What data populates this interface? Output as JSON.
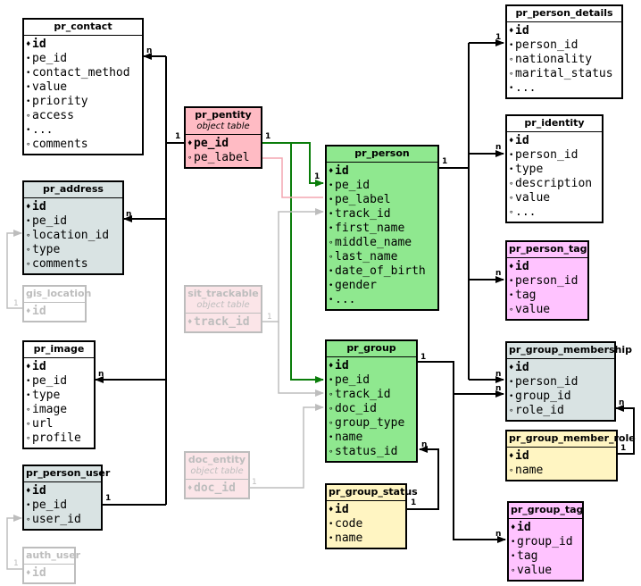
{
  "markers": {
    "pk": "♦",
    "required": "•",
    "optional": "∘"
  },
  "tables": [
    {
      "id": "pr_contact",
      "name": "pr_contact",
      "color": "white",
      "fields": [
        {
          "name": "id",
          "kind": "pk"
        },
        {
          "name": "pe_id",
          "kind": "required"
        },
        {
          "name": "contact_method",
          "kind": "required"
        },
        {
          "name": "value",
          "kind": "required"
        },
        {
          "name": "priority",
          "kind": "required"
        },
        {
          "name": "access",
          "kind": "optional"
        },
        {
          "name": "...",
          "kind": "required"
        },
        {
          "name": "comments",
          "kind": "optional"
        }
      ]
    },
    {
      "id": "pr_address",
      "name": "pr_address",
      "color": "gray",
      "fields": [
        {
          "name": "id",
          "kind": "pk"
        },
        {
          "name": "pe_id",
          "kind": "required"
        },
        {
          "name": "location_id",
          "kind": "optional"
        },
        {
          "name": "type",
          "kind": "optional"
        },
        {
          "name": "comments",
          "kind": "optional"
        }
      ]
    },
    {
      "id": "gis_location",
      "name": "gis_location",
      "color": "faded",
      "fields": [
        {
          "name": "id",
          "kind": "pk"
        }
      ]
    },
    {
      "id": "pr_image",
      "name": "pr_image",
      "color": "white",
      "fields": [
        {
          "name": "id",
          "kind": "pk"
        },
        {
          "name": "pe_id",
          "kind": "required"
        },
        {
          "name": "type",
          "kind": "required"
        },
        {
          "name": "image",
          "kind": "optional"
        },
        {
          "name": "url",
          "kind": "optional"
        },
        {
          "name": "profile",
          "kind": "optional"
        }
      ]
    },
    {
      "id": "pr_person_user",
      "name": "pr_person_user",
      "color": "gray",
      "fields": [
        {
          "name": "id",
          "kind": "pk"
        },
        {
          "name": "pe_id",
          "kind": "required"
        },
        {
          "name": "user_id",
          "kind": "optional"
        }
      ]
    },
    {
      "id": "auth_user",
      "name": "auth_user",
      "color": "faded",
      "fields": [
        {
          "name": "id",
          "kind": "pk"
        }
      ]
    },
    {
      "id": "pr_pentity",
      "name": "pr_pentity",
      "subtitle": "object table",
      "color": "pink",
      "fields": [
        {
          "name": "pe_id",
          "kind": "pk"
        },
        {
          "name": "pe_label",
          "kind": "optional"
        }
      ]
    },
    {
      "id": "sit_trackable",
      "name": "sit_trackable",
      "subtitle": "object table",
      "color": "fadedpink",
      "fields": [
        {
          "name": "track_id",
          "kind": "pk"
        }
      ]
    },
    {
      "id": "doc_entity",
      "name": "doc_entity",
      "subtitle": "object table",
      "color": "fadedpink",
      "fields": [
        {
          "name": "doc_id",
          "kind": "pk"
        }
      ]
    },
    {
      "id": "pr_person",
      "name": "pr_person",
      "color": "green",
      "fields": [
        {
          "name": "id",
          "kind": "pk"
        },
        {
          "name": "pe_id",
          "kind": "required"
        },
        {
          "name": "pe_label",
          "kind": "required"
        },
        {
          "name": "track_id",
          "kind": "required"
        },
        {
          "name": "first_name",
          "kind": "required"
        },
        {
          "name": "middle_name",
          "kind": "optional"
        },
        {
          "name": "last_name",
          "kind": "optional"
        },
        {
          "name": "date_of_birth",
          "kind": "required"
        },
        {
          "name": "gender",
          "kind": "required"
        },
        {
          "name": "...",
          "kind": "required"
        }
      ]
    },
    {
      "id": "pr_group",
      "name": "pr_group",
      "color": "green",
      "fields": [
        {
          "name": "id",
          "kind": "pk"
        },
        {
          "name": "pe_id",
          "kind": "required"
        },
        {
          "name": "track_id",
          "kind": "optional"
        },
        {
          "name": "doc_id",
          "kind": "optional"
        },
        {
          "name": "group_type",
          "kind": "optional"
        },
        {
          "name": "name",
          "kind": "required"
        },
        {
          "name": "status_id",
          "kind": "optional"
        }
      ]
    },
    {
      "id": "pr_group_status",
      "name": "pr_group_status",
      "color": "yellow",
      "fields": [
        {
          "name": "id",
          "kind": "pk"
        },
        {
          "name": "code",
          "kind": "required"
        },
        {
          "name": "name",
          "kind": "required"
        }
      ]
    },
    {
      "id": "pr_person_details",
      "name": "pr_person_details",
      "color": "white",
      "fields": [
        {
          "name": "id",
          "kind": "pk"
        },
        {
          "name": "person_id",
          "kind": "required"
        },
        {
          "name": "nationality",
          "kind": "optional"
        },
        {
          "name": "marital_status",
          "kind": "optional"
        },
        {
          "name": "...",
          "kind": "required"
        }
      ]
    },
    {
      "id": "pr_identity",
      "name": "pr_identity",
      "color": "white",
      "fields": [
        {
          "name": "id",
          "kind": "pk"
        },
        {
          "name": "person_id",
          "kind": "required"
        },
        {
          "name": "type",
          "kind": "required"
        },
        {
          "name": "description",
          "kind": "optional"
        },
        {
          "name": "value",
          "kind": "optional"
        },
        {
          "name": "...",
          "kind": "optional"
        }
      ]
    },
    {
      "id": "pr_person_tag",
      "name": "pr_person_tag",
      "color": "magenta",
      "fields": [
        {
          "name": "id",
          "kind": "pk"
        },
        {
          "name": "person_id",
          "kind": "required"
        },
        {
          "name": "tag",
          "kind": "required"
        },
        {
          "name": "value",
          "kind": "optional"
        }
      ]
    },
    {
      "id": "pr_group_membership",
      "name": "pr_group_membership",
      "color": "gray",
      "fields": [
        {
          "name": "id",
          "kind": "pk"
        },
        {
          "name": "person_id",
          "kind": "required"
        },
        {
          "name": "group_id",
          "kind": "required"
        },
        {
          "name": "role_id",
          "kind": "optional"
        }
      ]
    },
    {
      "id": "pr_group_member_role",
      "name": "pr_group_member_role",
      "color": "yellow",
      "fields": [
        {
          "name": "id",
          "kind": "pk"
        },
        {
          "name": "name",
          "kind": "optional"
        }
      ]
    },
    {
      "id": "pr_group_tag",
      "name": "pr_group_tag",
      "color": "magenta",
      "fields": [
        {
          "name": "id",
          "kind": "pk"
        },
        {
          "name": "group_id",
          "kind": "required"
        },
        {
          "name": "tag",
          "kind": "required"
        },
        {
          "name": "value",
          "kind": "optional"
        }
      ]
    }
  ],
  "edge_labels": {
    "one": "1",
    "many": "n"
  },
  "colors": {
    "edge": "#000000",
    "inherit": "#0a7d0a",
    "faded": "#bdbdbd",
    "pink_link": "#f3a6b0"
  }
}
